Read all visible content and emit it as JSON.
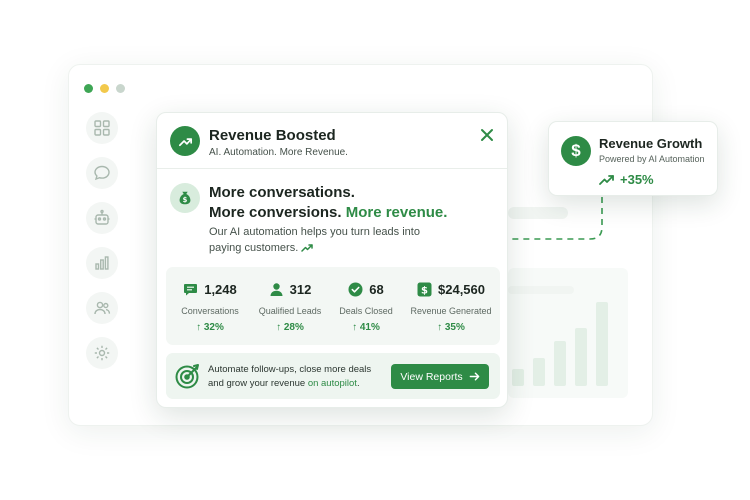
{
  "colors": {
    "accent": "#2e8b46",
    "accent_soft": "#d8ecdd",
    "dot_green": "#3ea655",
    "dot_yellow": "#f2c94c",
    "dot_gray": "#c9d6cd"
  },
  "sidebar": {
    "items": [
      {
        "icon": "grid-icon"
      },
      {
        "icon": "chat-bubble-icon"
      },
      {
        "icon": "robot-icon"
      },
      {
        "icon": "bar-chart-icon"
      },
      {
        "icon": "users-icon"
      },
      {
        "icon": "gear-icon"
      }
    ]
  },
  "card": {
    "title": "Revenue Boosted",
    "subtitle": "AI. Automation. More Revenue.",
    "hero_line1": "More conversations.",
    "hero_line2_a": "More conversions.",
    "hero_line2_b": "More revenue.",
    "description": "Our AI automation helps you turn leads into paying customers.",
    "stats": [
      {
        "icon": "chat-icon",
        "value": "1,248",
        "label": "Conversations",
        "delta": "↑ 32%"
      },
      {
        "icon": "user-icon",
        "value": "312",
        "label": "Qualified Leads",
        "delta": "↑ 28%"
      },
      {
        "icon": "check-circle-icon",
        "value": "68",
        "label": "Deals Closed",
        "delta": "↑ 41%"
      },
      {
        "icon": "dollar-icon",
        "value": "$24,560",
        "label": "Revenue Generated",
        "delta": "↑ 35%"
      }
    ],
    "footer_text_a": "Automate follow-ups, close more deals and grow your revenue",
    "footer_text_b": "on autopilot",
    "footer_text_c": ".",
    "cta_label": "View Reports"
  },
  "growth": {
    "icon_glyph": "$",
    "title": "Revenue Growth",
    "subtitle": "Powered by AI Automation",
    "delta": "+35%"
  },
  "bg_chart": {
    "values": [
      0.2,
      0.32,
      0.52,
      0.68,
      0.98
    ]
  }
}
